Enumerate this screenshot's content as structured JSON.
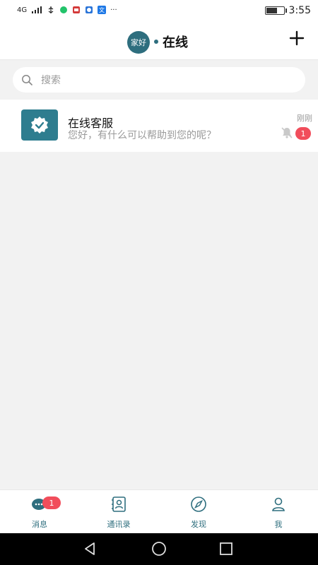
{
  "status_bar": {
    "network": "4G",
    "time": "3:55",
    "more": "···"
  },
  "header": {
    "avatar_text": "家好",
    "title": "在线",
    "add_icon": "plus-icon"
  },
  "search": {
    "placeholder": "搜索",
    "icon": "search-icon"
  },
  "chat_list": [
    {
      "name": "在线客服",
      "preview": "您好，有什么可以帮助到您的呢？",
      "time": "刚刚",
      "unread": "1",
      "muted_icon": "mute-bell-icon"
    }
  ],
  "bottom_nav": {
    "items": [
      {
        "label": "消息",
        "icon": "messages-icon",
        "badge": "1"
      },
      {
        "label": "通讯录",
        "icon": "contacts-icon"
      },
      {
        "label": "发现",
        "icon": "compass-icon"
      },
      {
        "label": "我",
        "icon": "profile-icon"
      }
    ]
  },
  "colors": {
    "accent": "#2e6e7e",
    "badge": "#f14d5b",
    "background": "#f2f2f2"
  }
}
